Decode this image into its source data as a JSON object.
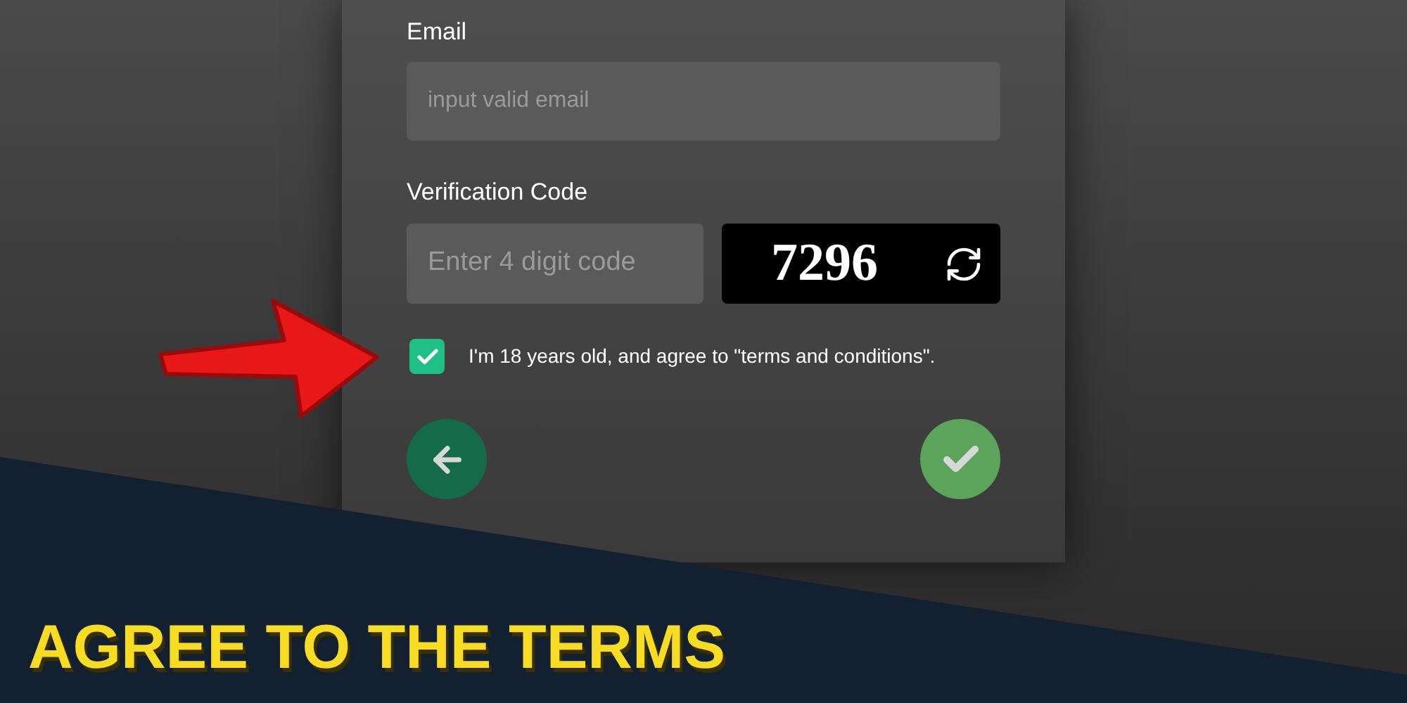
{
  "form": {
    "email": {
      "label": "Email",
      "placeholder": "input valid email"
    },
    "verification": {
      "label": "Verification Code",
      "placeholder": "Enter 4 digit code",
      "captcha": "7296"
    },
    "agree": {
      "checked": true,
      "label": "I'm 18 years old, and agree to \"terms and conditions\"."
    },
    "buttons": [
      {
        "kind": "back"
      },
      {
        "kind": "submit"
      }
    ]
  },
  "banner": {
    "title": "AGREE TO THE TERMS"
  }
}
